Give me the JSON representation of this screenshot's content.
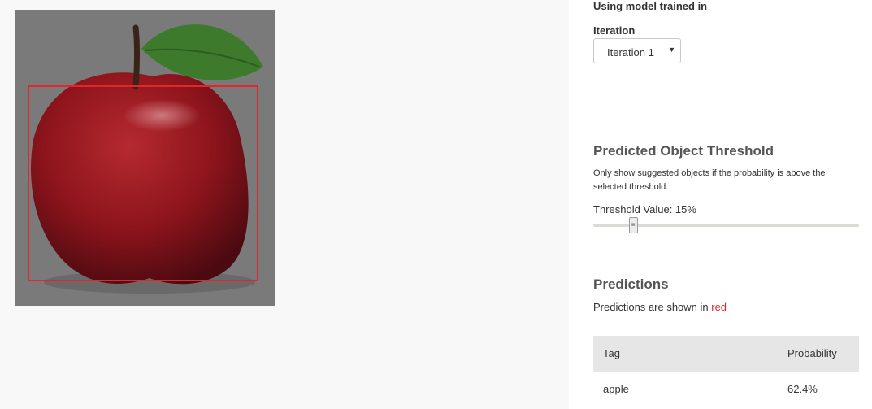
{
  "image": {
    "subject": "apple"
  },
  "sidebar": {
    "model_label": "Using model trained in",
    "iteration_label": "Iteration",
    "iteration_select_value": "Iteration 1",
    "threshold_heading": "Predicted Object Threshold",
    "threshold_description": "Only show suggested objects if the probability is above the selected threshold.",
    "threshold_value_label": "Threshold Value: 15%",
    "threshold_value": 0.15,
    "predictions_heading": "Predictions",
    "predictions_note_prefix": "Predictions are shown in ",
    "predictions_note_color_word": "red",
    "table": {
      "headers": [
        "Tag",
        "Probability"
      ],
      "rows": [
        {
          "tag": "apple",
          "probability": "62.4%"
        }
      ]
    }
  },
  "colors": {
    "prediction_box": "#e2262b",
    "header_bg": "#e6e6e6"
  }
}
